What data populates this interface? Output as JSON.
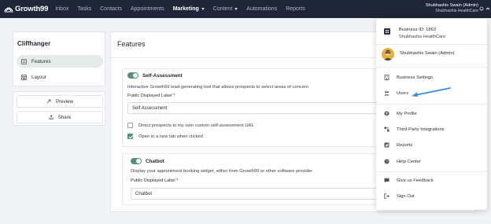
{
  "topbar": {
    "logo_text": "Growth99",
    "nav": [
      {
        "label": "Inbox",
        "active": false
      },
      {
        "label": "Tasks",
        "active": false
      },
      {
        "label": "Contacts",
        "active": false
      },
      {
        "label": "Appointments",
        "active": false
      },
      {
        "label": "Marketing",
        "active": true,
        "has_caret": true
      },
      {
        "label": "Content",
        "active": false,
        "has_caret": true
      },
      {
        "label": "Automations",
        "active": false
      },
      {
        "label": "Reports",
        "active": false
      }
    ],
    "user_name": "Shubhashis Swain (Admin)",
    "user_org": "Shubhashis HealthCare"
  },
  "sidebar": {
    "title": "Cliffhanger",
    "items": [
      {
        "label": "Features",
        "icon": "features-icon",
        "active": true
      },
      {
        "label": "Layout",
        "icon": "layout-icon",
        "active": false
      }
    ],
    "actions": [
      {
        "label": "Preview",
        "icon": "external-link-icon"
      },
      {
        "label": "Share",
        "icon": "share-icon"
      }
    ]
  },
  "main": {
    "title": "Features",
    "self_assessment": {
      "name": "Self-Assessment",
      "enabled": true,
      "description": "Interactive Growth99 lead-generating tool that allows prospects to select areas of concern",
      "label_title": "Public Displayed Label *",
      "label_value": "Self Assessment",
      "options": [
        {
          "label": "Direct prospects to my own custom self-assessment URL",
          "checked": false
        },
        {
          "label": "Open in a new tab when clicked",
          "checked": true
        }
      ]
    },
    "chatbot": {
      "name": "Chatbot",
      "enabled": true,
      "description": "Display your appointment booking widget, either from Growth99 or other software provider",
      "label_title": "Public Displayed Label *",
      "label_value": "Chatbot"
    }
  },
  "dropdown": {
    "business_id": "Business ID: 1863",
    "business_name": "Shubhashis HealthCare",
    "user": "Shubhashis Swain (Admin)",
    "items": [
      {
        "label": "Business Settings",
        "icon": "building-icon"
      },
      {
        "label": "Users",
        "icon": "users-icon"
      },
      {
        "label": "My Profile",
        "icon": "profile-icon"
      },
      {
        "label": "Third-Party Integrations",
        "icon": "integrations-icon"
      },
      {
        "label": "Reports",
        "icon": "reports-icon"
      },
      {
        "label": "Help Center",
        "icon": "help-icon"
      },
      {
        "label": "Give us Feedback",
        "icon": "feedback-icon"
      },
      {
        "label": "Sign Out",
        "icon": "sign-out-icon"
      }
    ]
  },
  "colors": {
    "topbar_bg": "#1f2637",
    "accent_green": "#5a8f7b",
    "arrow_blue": "#3b8fe0",
    "avatar_bg": "#e7b23c"
  }
}
